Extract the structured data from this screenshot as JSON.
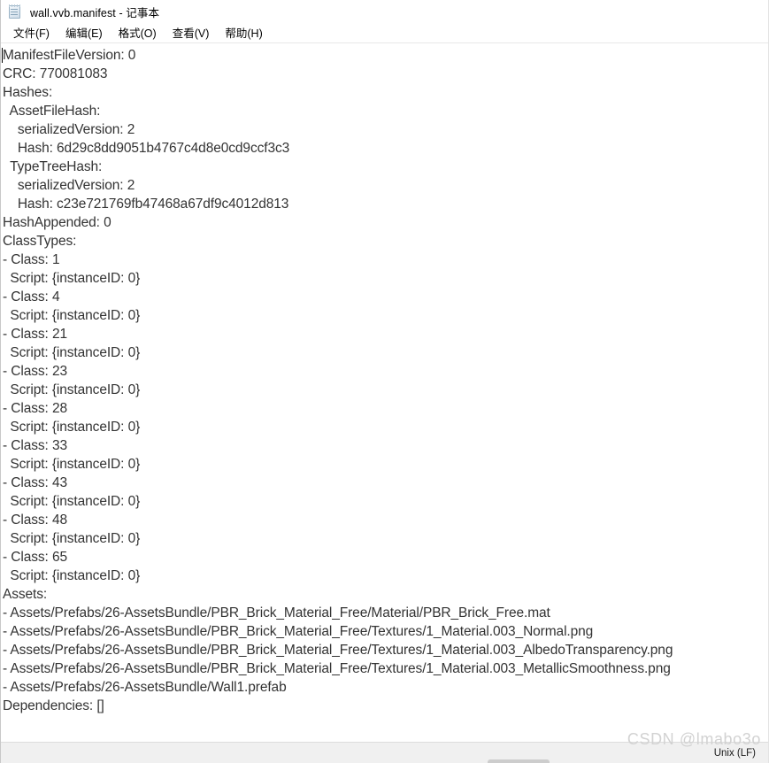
{
  "window": {
    "title": "wall.vvb.manifest - 记事本",
    "icon": "notepad-icon"
  },
  "menu": {
    "items": [
      {
        "label": "文件(F)",
        "name": "menu-file"
      },
      {
        "label": "编辑(E)",
        "name": "menu-edit"
      },
      {
        "label": "格式(O)",
        "name": "menu-format"
      },
      {
        "label": "查看(V)",
        "name": "menu-view"
      },
      {
        "label": "帮助(H)",
        "name": "menu-help"
      }
    ]
  },
  "document": {
    "text": "ManifestFileVersion: 0\nCRC: 770081083\nHashes:\n  AssetFileHash:\n    serializedVersion: 2\n    Hash: 6d29c8dd9051b4767c4d8e0cd9ccf3c3\n  TypeTreeHash:\n    serializedVersion: 2\n    Hash: c23e721769fb47468a67df9c4012d813\nHashAppended: 0\nClassTypes:\n- Class: 1\n  Script: {instanceID: 0}\n- Class: 4\n  Script: {instanceID: 0}\n- Class: 21\n  Script: {instanceID: 0}\n- Class: 23\n  Script: {instanceID: 0}\n- Class: 28\n  Script: {instanceID: 0}\n- Class: 33\n  Script: {instanceID: 0}\n- Class: 43\n  Script: {instanceID: 0}\n- Class: 48\n  Script: {instanceID: 0}\n- Class: 65\n  Script: {instanceID: 0}\nAssets:\n- Assets/Prefabs/26-AssetsBundle/PBR_Brick_Material_Free/Material/PBR_Brick_Free.mat\n- Assets/Prefabs/26-AssetsBundle/PBR_Brick_Material_Free/Textures/1_Material.003_Normal.png\n- Assets/Prefabs/26-AssetsBundle/PBR_Brick_Material_Free/Textures/1_Material.003_AlbedoTransparency.png\n- Assets/Prefabs/26-AssetsBundle/PBR_Brick_Material_Free/Textures/1_Material.003_MetallicSmoothness.png\n- Assets/Prefabs/26-AssetsBundle/Wall1.prefab\nDependencies: []",
    "fields": {
      "manifest_file_version": "0",
      "crc": "770081083",
      "asset_file_hash_serialized_version": "2",
      "asset_file_hash": "6d29c8dd9051b4767c4d8e0cd9ccf3c3",
      "type_tree_hash_serialized_version": "2",
      "type_tree_hash": "c23e721769fb47468a67df9c4012d813",
      "hash_appended": "0",
      "class_types": [
        "1",
        "4",
        "21",
        "23",
        "28",
        "33",
        "43",
        "48",
        "65"
      ],
      "script_value": "{instanceID: 0}",
      "assets": [
        "Assets/Prefabs/26-AssetsBundle/PBR_Brick_Material_Free/Material/PBR_Brick_Free.mat",
        "Assets/Prefabs/26-AssetsBundle/PBR_Brick_Material_Free/Textures/1_Material.003_Normal.png",
        "Assets/Prefabs/26-AssetsBundle/PBR_Brick_Material_Free/Textures/1_Material.003_AlbedoTransparency.png",
        "Assets/Prefabs/26-AssetsBundle/PBR_Brick_Material_Free/Textures/1_Material.003_MetallicSmoothness.png",
        "Assets/Prefabs/26-AssetsBundle/Wall1.prefab"
      ],
      "dependencies": "[]"
    }
  },
  "status_bar": {
    "line_ending": "Unix (LF)"
  },
  "watermark": {
    "text": "CSDN @lmabo3o"
  },
  "colors": {
    "text": "#333333",
    "title": "#000000",
    "status_bg": "#f0f0f0",
    "watermark": "#d2d2d2"
  }
}
